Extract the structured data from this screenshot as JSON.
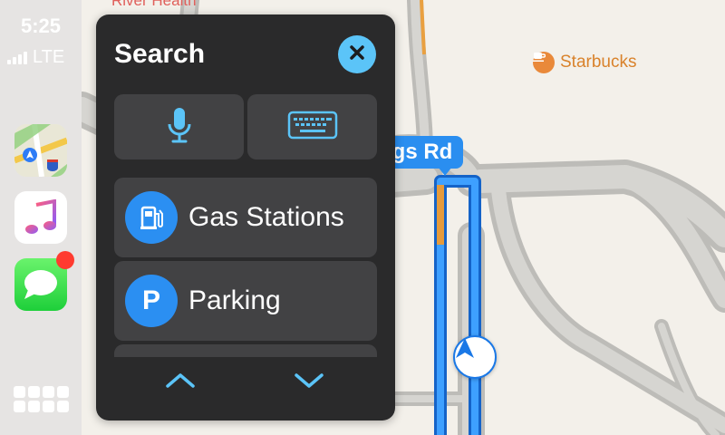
{
  "status": {
    "time": "5:25",
    "network": "LTE"
  },
  "dock": {
    "apps": [
      {
        "name": "Maps",
        "icon": "maps-app-icon"
      },
      {
        "name": "Music",
        "icon": "music-app-icon"
      },
      {
        "name": "Messages",
        "icon": "messages-app-icon",
        "badge": true
      }
    ],
    "home_icon": "app-grid-icon"
  },
  "map": {
    "poi_starbucks": "Starbucks",
    "poi_hospital": "River Health",
    "road_label": "ngs Rd",
    "route_color": "#1a78e6"
  },
  "search": {
    "title": "Search",
    "voice_icon": "microphone-icon",
    "keyboard_icon": "keyboard-icon",
    "categories": [
      {
        "label": "Gas Stations",
        "icon": "gas-pump-icon"
      },
      {
        "label": "Parking",
        "icon": "parking-icon",
        "glyph": "P"
      }
    ],
    "accent": "#5bc4f8"
  }
}
